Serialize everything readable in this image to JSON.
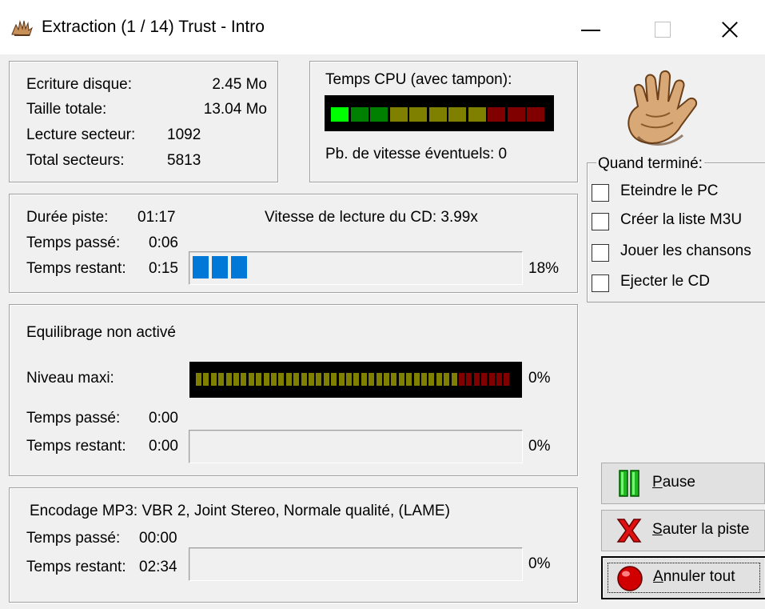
{
  "window": {
    "title": "Extraction (1 / 14)   Trust - Intro",
    "icon": "app-hand-icon",
    "controls": [
      "minimize-icon",
      "maximize-icon",
      "close-icon"
    ]
  },
  "disk": {
    "write_label": "Ecriture disque:",
    "write_value": "2.45 Mo",
    "total_size_label": "Taille totale:",
    "total_size_value": "13.04 Mo",
    "sector_read_label": "Lecture secteur:",
    "sector_read_value": "1092",
    "total_sectors_label": "Total secteurs:",
    "total_sectors_value": "5813"
  },
  "cpu": {
    "title": "Temps CPU (avec tampon):",
    "speed_issues": "Pb. de vitesse éventuels: 0",
    "segments_lit": 1,
    "segments_total": 11,
    "colors": {
      "lit_green": "#00ff00",
      "dim_green": "#008000",
      "dim_olive": "#808000",
      "dim_red": "#800000"
    }
  },
  "track": {
    "duration_label": "Durée piste:",
    "duration_value": "01:17",
    "cd_speed": "Vitesse de lecture du CD: 3.99x",
    "elapsed_label": "Temps passé:",
    "elapsed_value": "0:06",
    "remaining_label": "Temps restant:",
    "remaining_value": "0:15",
    "progress": 0.18,
    "progress_text": "18%"
  },
  "normalize": {
    "status": "Equilibrage non activé",
    "level_label": "Niveau maxi:",
    "level_text": "0%",
    "elapsed_label": "Temps passé:",
    "elapsed_value": "0:00",
    "remaining_label": "Temps restant:",
    "remaining_value": "0:00",
    "progress_text": "0%"
  },
  "encode": {
    "title": "Encodage MP3: VBR 2, Joint Stereo, Normale qualité, (LAME)",
    "elapsed_label": "Temps passé:",
    "elapsed_value": "00:00",
    "remaining_label": "Temps restant:",
    "remaining_value": "02:34",
    "progress_text": "0%"
  },
  "when_done": {
    "title": "Quand terminé:",
    "options": [
      {
        "label": "Eteindre le PC",
        "checked": false
      },
      {
        "label": "Créer la liste M3U",
        "checked": false
      },
      {
        "label": "Jouer les chansons",
        "checked": false
      },
      {
        "label": "Ejecter le CD",
        "checked": false
      }
    ]
  },
  "buttons": {
    "pause": {
      "label_mnemonic": "P",
      "label_rest": "ause",
      "icon": "pause-icon"
    },
    "skip": {
      "label_mnemonic": "S",
      "label_rest": "auter la piste",
      "icon": "red-x-icon"
    },
    "cancel": {
      "label_mnemonic": "A",
      "label_rest": "nnuler tout",
      "icon": "stop-ball-icon"
    }
  }
}
